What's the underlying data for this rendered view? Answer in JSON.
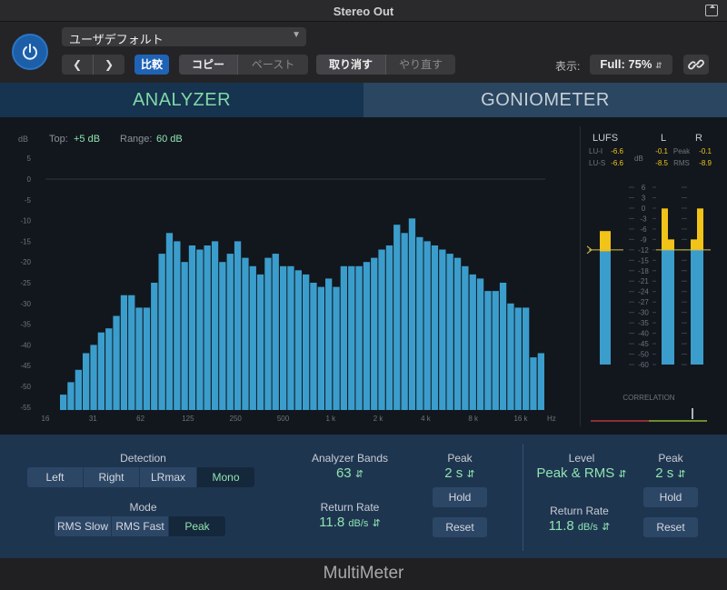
{
  "window": {
    "title": "Stereo Out"
  },
  "header": {
    "preset": "ユーザデフォルト",
    "compare": "比較",
    "copy": "コピー",
    "paste": "ペースト",
    "undo": "取り消す",
    "redo": "やり直す",
    "zoom_label": "表示:",
    "zoom_value": "Full: 75%"
  },
  "tabs": [
    {
      "label": "ANALYZER"
    },
    {
      "label": "GONIOMETER"
    }
  ],
  "analyzer": {
    "db_label": "dB",
    "top_label": "Top:",
    "top_value": "+5 dB",
    "range_label": "Range:",
    "range_value": "60 dB",
    "y_ticks": [
      "5",
      "0",
      "-5",
      "-10",
      "-15",
      "-20",
      "-25",
      "-30",
      "-35",
      "-40",
      "-45",
      "-50",
      "-55"
    ],
    "x_ticks": [
      "16",
      "31",
      "62",
      "125",
      "250",
      "500",
      "1 k",
      "2 k",
      "4 k",
      "8 k",
      "16 k"
    ],
    "x_unit": "Hz",
    "bands_db": [
      -52,
      -49,
      -46,
      -42,
      -40,
      -37,
      -36,
      -33,
      -28,
      -28,
      -31,
      -31,
      -25,
      -18,
      -13,
      -15,
      -20,
      -16,
      -17,
      -16,
      -15,
      -20,
      -18,
      -15,
      -19,
      -21,
      -23,
      -19,
      -18,
      -21,
      -21,
      -22,
      -23,
      -25,
      -26,
      -24,
      -26,
      -21,
      -21,
      -21,
      -20,
      -19,
      -17,
      -16,
      -11,
      -13,
      -9.5,
      -14,
      -15,
      -16,
      -17,
      -18,
      -19,
      -21,
      -23,
      -24,
      -27,
      -27,
      -25,
      -30,
      -31,
      -31,
      -43,
      -42
    ]
  },
  "meters": {
    "lufs_label": "LUFS",
    "lu_i_label": "LU-I",
    "lu_i_value": "-6.6",
    "lu_s_label": "LU-S",
    "lu_s_value": "-6.6",
    "l_label": "L",
    "r_label": "R",
    "peak_label": "Peak",
    "rms_label": "RMS",
    "l_peak": "-0.1",
    "l_rms": "-8.5",
    "r_peak": "-0.1",
    "r_rms": "-8.9",
    "db_label": "dB",
    "scale": [
      "6",
      "3",
      "0",
      "-3",
      "-6",
      "-9",
      "-12",
      "-15",
      "-18",
      "-21",
      "-24",
      "-27",
      "-30",
      "-35",
      "-40",
      "-45",
      "-50",
      "-60"
    ],
    "correlation_label": "CORRELATION",
    "lufs_level": -6.6,
    "l_peak_level": -0.1,
    "l_rms_level": -8.5,
    "r_peak_level": -0.1,
    "r_rms_level": -8.9
  },
  "controls": {
    "detection_label": "Detection",
    "detection_options": [
      "Left",
      "Right",
      "LRmax",
      "Mono"
    ],
    "mode_label": "Mode",
    "mode_options": [
      "RMS Slow",
      "RMS Fast",
      "Peak"
    ],
    "bands_label": "Analyzer Bands",
    "bands_value": "63",
    "return_rate_label": "Return Rate",
    "return_rate_value": "11.8",
    "return_rate_unit": "dB/s",
    "peak_label": "Peak",
    "peak_value": "2 s",
    "hold": "Hold",
    "reset": "Reset",
    "level_label": "Level",
    "level_value": "Peak & RMS",
    "level_peak_label": "Peak",
    "level_peak_value": "2 s",
    "level_hold": "Hold",
    "level_return_rate_label": "Return Rate",
    "level_return_rate_value": "11.8",
    "level_return_rate_unit": "dB/s",
    "level_reset": "Reset"
  },
  "footer": {
    "plugin_name": "MultiMeter"
  }
}
